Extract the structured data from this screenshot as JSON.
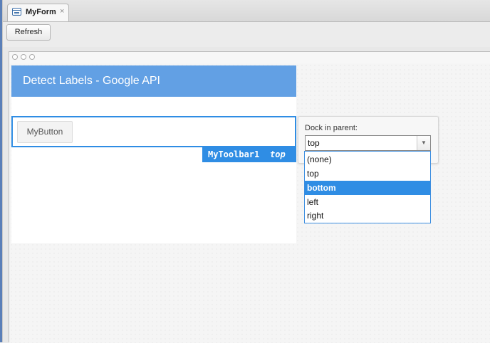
{
  "tab": {
    "title": "MyForm",
    "close": "×"
  },
  "toolbar": {
    "refresh_label": "Refresh"
  },
  "form": {
    "title": "Detect Labels - Google API"
  },
  "component": {
    "button_label": "MyButton",
    "selection_name": "MyToolbar1",
    "selection_dock": "top"
  },
  "property": {
    "label": "Dock in parent:",
    "value": "top",
    "arrow": "▼",
    "options": [
      "(none)",
      "top",
      "bottom",
      "left",
      "right"
    ],
    "highlighted": "bottom"
  },
  "colors": {
    "accent": "#2f8de4",
    "header": "#62a0e4"
  }
}
